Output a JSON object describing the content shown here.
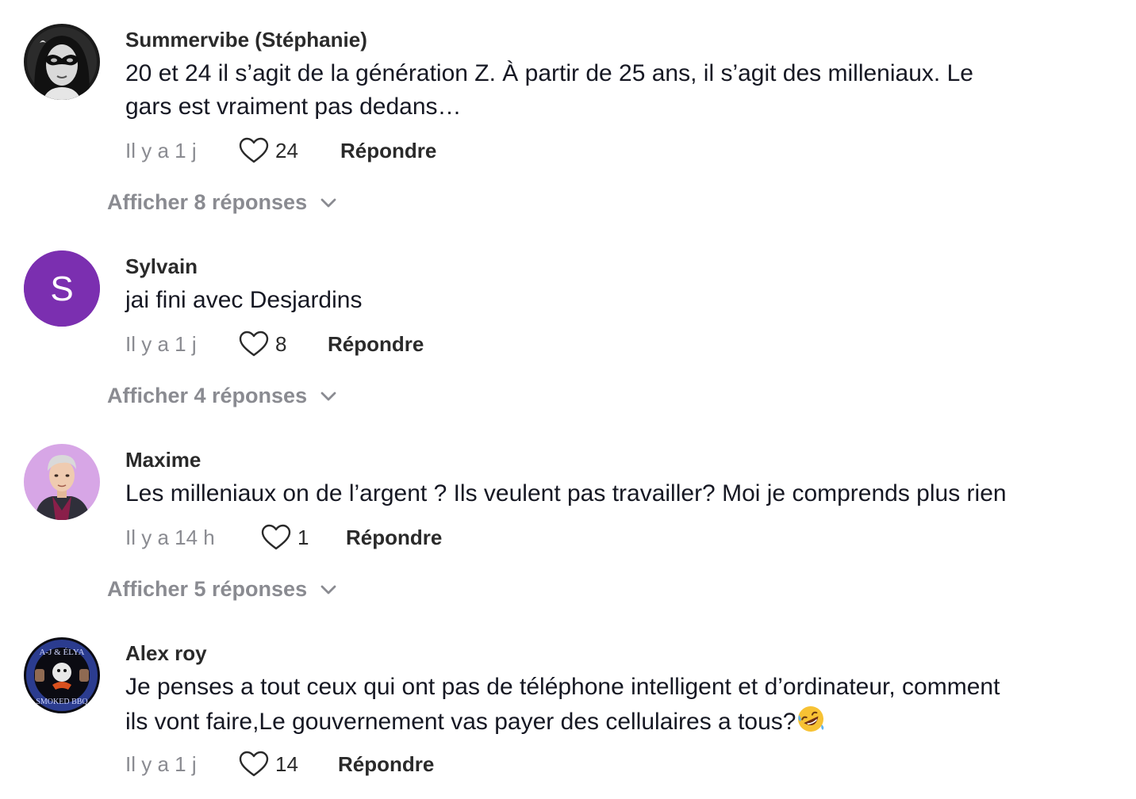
{
  "comments": [
    {
      "username": "Summervibe (Stéphanie)",
      "text_lines": [
        "20 et 24 il s’agit de la génération Z. À partir de 25 ans, il s’agit des milleniaux. Le",
        "gars est vraiment pas dedans…"
      ],
      "time": "Il y a 1 j",
      "likes": "24",
      "reply_label": "Répondre",
      "show_replies": "Afficher 8 réponses",
      "avatar": "masked-woman-avatar"
    },
    {
      "username": "Sylvain",
      "text_lines": [
        "jai fini avec Desjardins"
      ],
      "time": "Il y a 1 j",
      "likes": "8",
      "reply_label": "Répondre",
      "show_replies": "Afficher 4 réponses",
      "avatar": "letter-avatar",
      "avatar_letter": "S",
      "avatar_color": "#7b2fb0"
    },
    {
      "username": "Maxime",
      "text_lines": [
        "Les milleniaux on de l’argent ? Ils veulent pas travailler? Moi je comprends plus rien"
      ],
      "time": "Il y a 14 h",
      "likes": "1",
      "reply_label": "Répondre",
      "show_replies": "Afficher 5 réponses",
      "avatar": "cartoon-man-avatar"
    },
    {
      "username": "Alex roy",
      "text_lines": [
        "Je penses a tout ceux qui ont pas de téléphone intelligent et d’ordinateur, comment",
        "ils vont faire,Le gouvernement vas payer des cellulaires a tous?"
      ],
      "emoji": "rolling-on-floor-laughing-emoji",
      "time": "Il y a 1 j",
      "likes": "14",
      "reply_label": "Répondre",
      "avatar": "bbq-logo-avatar",
      "avatar_logo_top": "A-J & ÉLYA",
      "avatar_logo_bottom": "SMOKED BBQ"
    }
  ],
  "colors": {
    "muted": "#8a8b91",
    "text": "#161823",
    "avatar_purple": "#7b2fb0"
  }
}
